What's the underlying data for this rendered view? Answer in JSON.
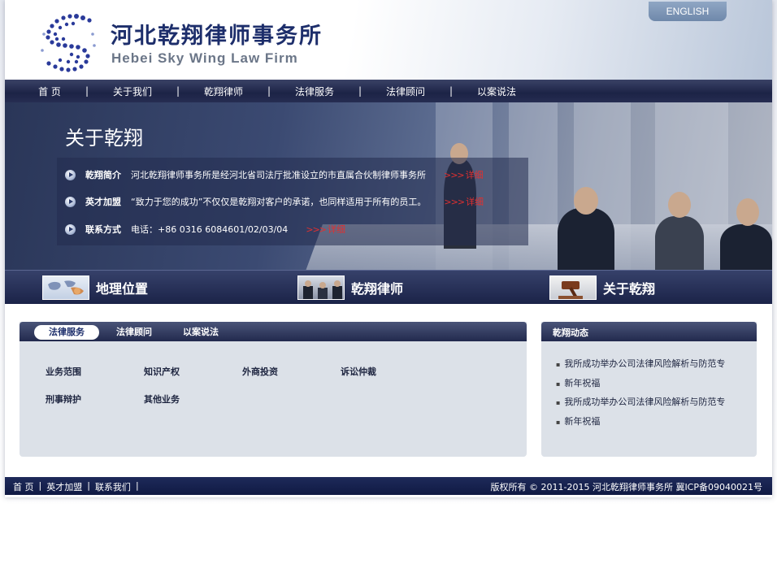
{
  "header": {
    "english_label": "ENGLISH",
    "logo_cn": "河北乾翔律师事务所",
    "logo_en": "Hebei Sky Wing Law Firm"
  },
  "nav": {
    "items": [
      "首 页",
      "关于我们",
      "乾翔律师",
      "法律服务",
      "法律顾问",
      "以案说法"
    ],
    "separator": "|"
  },
  "banner": {
    "title": "关于乾翔",
    "rows": [
      {
        "label": "乾翔简介",
        "text": "河北乾翔律师事务所是经河北省司法厅批准设立的市直属合伙制律师事务所",
        "more": "详细"
      },
      {
        "label": "英才加盟",
        "text": "“致力于您的成功”不仅仅是乾翔对客户的承诺，也同样适用于所有的员工。",
        "more": "详细"
      },
      {
        "label": "联系方式",
        "text": "电话：+86 0316 6084601/02/03/04",
        "more": "详细"
      }
    ],
    "arrows": ">>>"
  },
  "quick_links": {
    "items": [
      {
        "label": "地理位置",
        "icon": "world-map-icon"
      },
      {
        "label": "乾翔律师",
        "icon": "lawyers-meeting-icon"
      },
      {
        "label": "关于乾翔",
        "icon": "gavel-icon"
      }
    ]
  },
  "services": {
    "tabs": [
      "法律服务",
      "法律顾问",
      "以案说法"
    ],
    "active_tab": "法律服务",
    "links": [
      "业务范围",
      "知识产权",
      "外商投资",
      "诉讼仲裁",
      "刑事辩护",
      "其他业务"
    ]
  },
  "news": {
    "title": "乾翔动态",
    "items": [
      "我所成功举办公司法律风险解析与防范专",
      "新年祝福",
      "我所成功举办公司法律风险解析与防范专",
      "新年祝福"
    ]
  },
  "footer": {
    "links": [
      "首 页",
      "英才加盟",
      "联系我们"
    ],
    "separator": "|",
    "copyright": "版权所有 © 2011-2015 河北乾翔律师事务所 冀ICP备09040021号"
  },
  "colors": {
    "nav_dark": "#1c2346",
    "brand_blue": "#1d2e6b",
    "more_red": "#e03030",
    "panel_gray": "#dce1e8"
  }
}
